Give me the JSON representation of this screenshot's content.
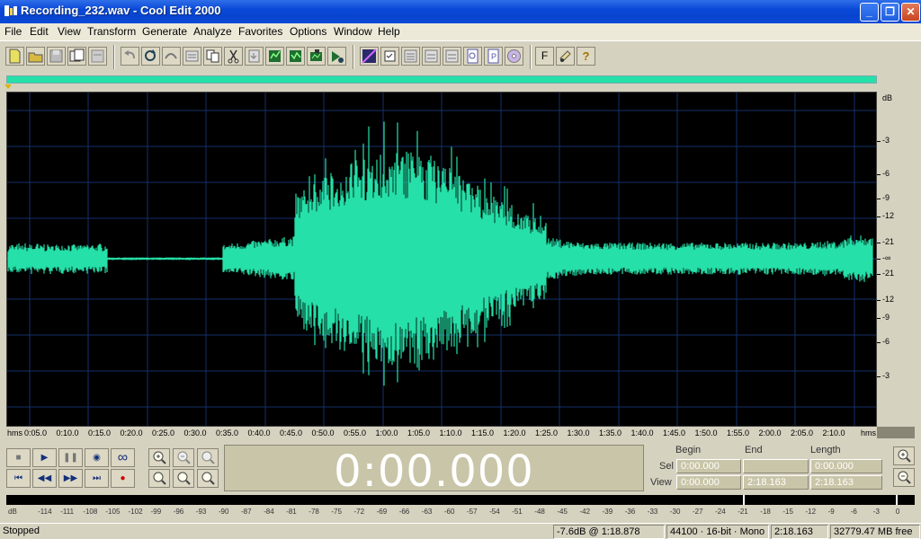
{
  "window": {
    "title": "Recording_232.wav - Cool Edit 2000",
    "minimize": "_",
    "restore": "❐",
    "close": "✕"
  },
  "menu": [
    "File",
    "Edit",
    "View",
    "Transform",
    "Generate",
    "Analyze",
    "Favorites",
    "Options",
    "Window",
    "Help"
  ],
  "toolbar": {
    "buttons": [
      "new-file-icon",
      "open-file-icon",
      "save-icon",
      "save-as-icon",
      "close-file-icon",
      "undo-icon",
      "repeat-icon",
      "loop-icon",
      "edit-wave-icon",
      "copy-icon",
      "cut-icon",
      "paste-icon",
      "paste-new-icon",
      "mix-paste-icon",
      "trim-icon",
      "play-icon",
      "spectral-view-icon",
      "cue-list-icon",
      "waveform-icon",
      "wave-display-icon",
      "preview-icon",
      "scripts-icon",
      "properties-icon",
      "cd-player-icon",
      "favorites-icon",
      "settings-icon",
      "help-icon"
    ],
    "f_label": "F",
    "help_label": "?"
  },
  "waveform": {
    "color": "#25e0a8",
    "background": "#000000",
    "db_unit": "dB",
    "db_labels": [
      "-3",
      "-6",
      "-9",
      "-12",
      "-21",
      "-∞",
      "-21",
      "-12",
      "-9",
      "-6",
      "-3"
    ]
  },
  "time_ruler": {
    "start_label": "hms",
    "end_label": "hms",
    "labels": [
      "0:05.0",
      "0:10.0",
      "0:15.0",
      "0:20.0",
      "0:25.0",
      "0:30.0",
      "0:35.0",
      "0:40.0",
      "0:45.0",
      "0:50.0",
      "0:55.0",
      "1:00.0",
      "1:05.0",
      "1:10.0",
      "1:15.0",
      "1:20.0",
      "1:25.0",
      "1:30.0",
      "1:35.0",
      "1:40.0",
      "1:45.0",
      "1:50.0",
      "1:55.0",
      "2:00.0",
      "2:05.0",
      "2:10.0"
    ]
  },
  "transport": {
    "stop": "■",
    "play": "▶",
    "pause": "❚❚",
    "play_to_end": "◉",
    "loop": "∞",
    "go_start": "⏮",
    "rewind": "◀◀",
    "forward": "▶▶",
    "go_end": "⏭",
    "record": "●"
  },
  "time_display": "0:00.000",
  "selection": {
    "headers": [
      "Begin",
      "End",
      "Length"
    ],
    "sel_label": "Sel",
    "view_label": "View",
    "sel_begin": "0:00.000",
    "sel_end": "",
    "sel_length": "0:00.000",
    "view_begin": "0:00.000",
    "view_end": "2:18.163",
    "view_length": "2:18.163"
  },
  "level_meter": {
    "labels": [
      "dB",
      "-114",
      "-111",
      "-108",
      "-105",
      "-102",
      "-99",
      "-96",
      "-93",
      "-90",
      "-87",
      "-84",
      "-81",
      "-78",
      "-75",
      "-72",
      "-69",
      "-66",
      "-63",
      "-60",
      "-57",
      "-54",
      "-51",
      "-48",
      "-45",
      "-42",
      "-39",
      "-36",
      "-33",
      "-30",
      "-27",
      "-24",
      "-21",
      "-18",
      "-15",
      "-12",
      "-9",
      "-6",
      "-3",
      "0"
    ]
  },
  "status": {
    "state": "Stopped",
    "cursor": "-7.6dB @   1:18.878",
    "format": "44100 · 16-bit · Mono",
    "duration": "2:18.163",
    "free": "32779.47 MB free"
  }
}
